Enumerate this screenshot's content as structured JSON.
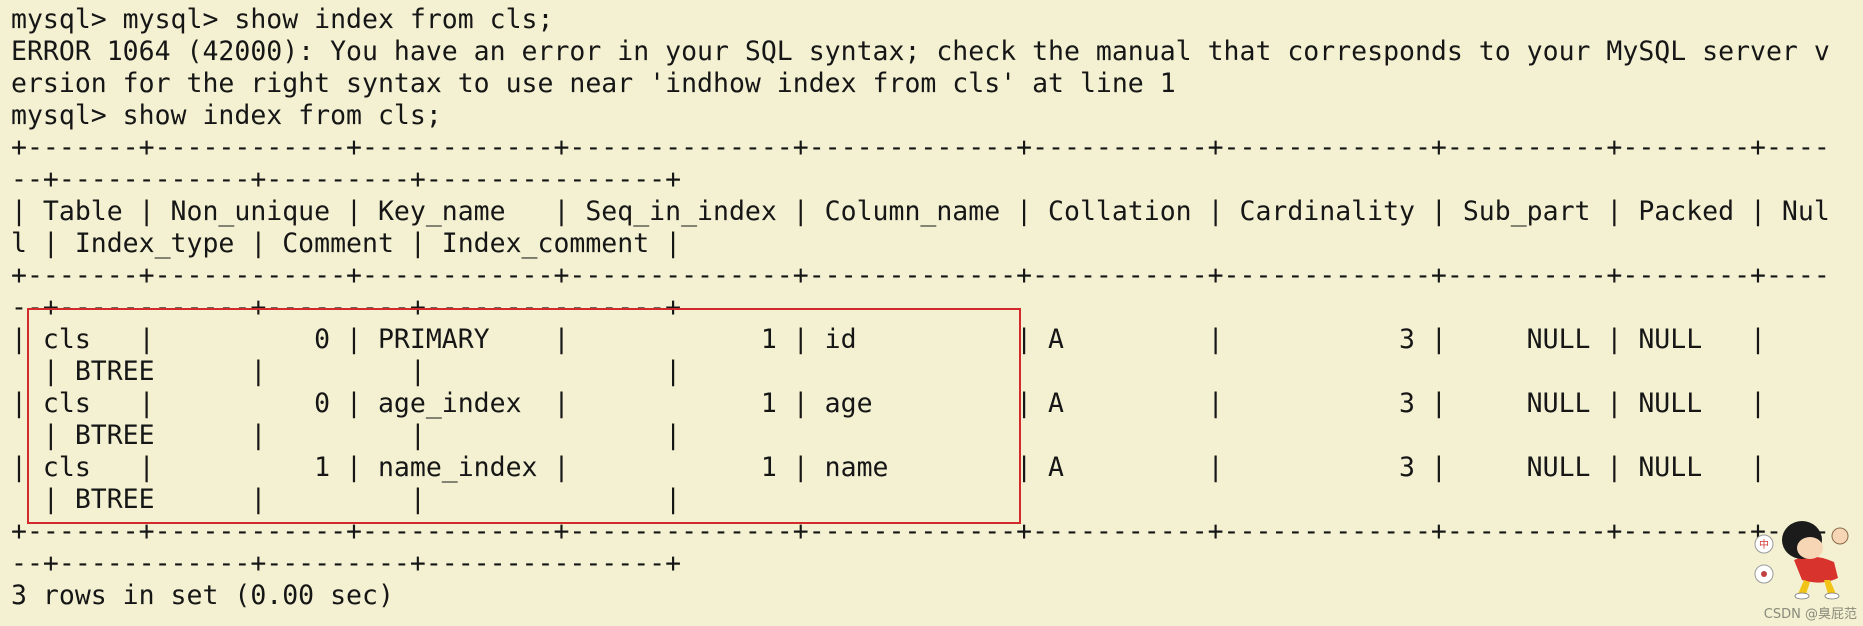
{
  "terminal": {
    "lines": [
      "mysql> mysql> show index from cls;",
      "ERROR 1064 (42000): You have an error in your SQL syntax; check the manual that corresponds to your MySQL server v",
      "ersion for the right syntax to use near 'indhow index from cls' at line 1",
      "mysql> show index from cls;",
      "+-------+------------+------------+--------------+-------------+-----------+-------------+----------+--------+----",
      "--+------------+---------+---------------+",
      "| Table | Non_unique | Key_name   | Seq_in_index | Column_name | Collation | Cardinality | Sub_part | Packed | Nul",
      "l | Index_type | Comment | Index_comment |",
      "+-------+------------+------------+--------------+-------------+-----------+-------------+----------+--------+----",
      "--+------------+---------+---------------+",
      "| cls   |          0 | PRIMARY    |            1 | id          | A         |           3 |     NULL | NULL   |",
      "  | BTREE      |         |               |",
      "| cls   |          0 | age_index  |            1 | age         | A         |           3 |     NULL | NULL   |",
      "  | BTREE      |         |               |",
      "| cls   |          1 | name_index |            1 | name        | A         |           3 |     NULL | NULL   |",
      "  | BTREE      |         |               |",
      "+-------+------------+------------+--------------+-------------+-----------+-------------+----------+--------+----",
      "--+------------+---------+---------------+",
      "3 rows in set (0.00 sec)"
    ]
  },
  "colors": {
    "background": "#f3f1d2",
    "text": "#161616",
    "highlight_border": "#d22a2a"
  },
  "watermark": {
    "text": "CSDN @臭屁范"
  },
  "mascot": {
    "icon": "crayon-shin-chan-sticker-icon"
  }
}
